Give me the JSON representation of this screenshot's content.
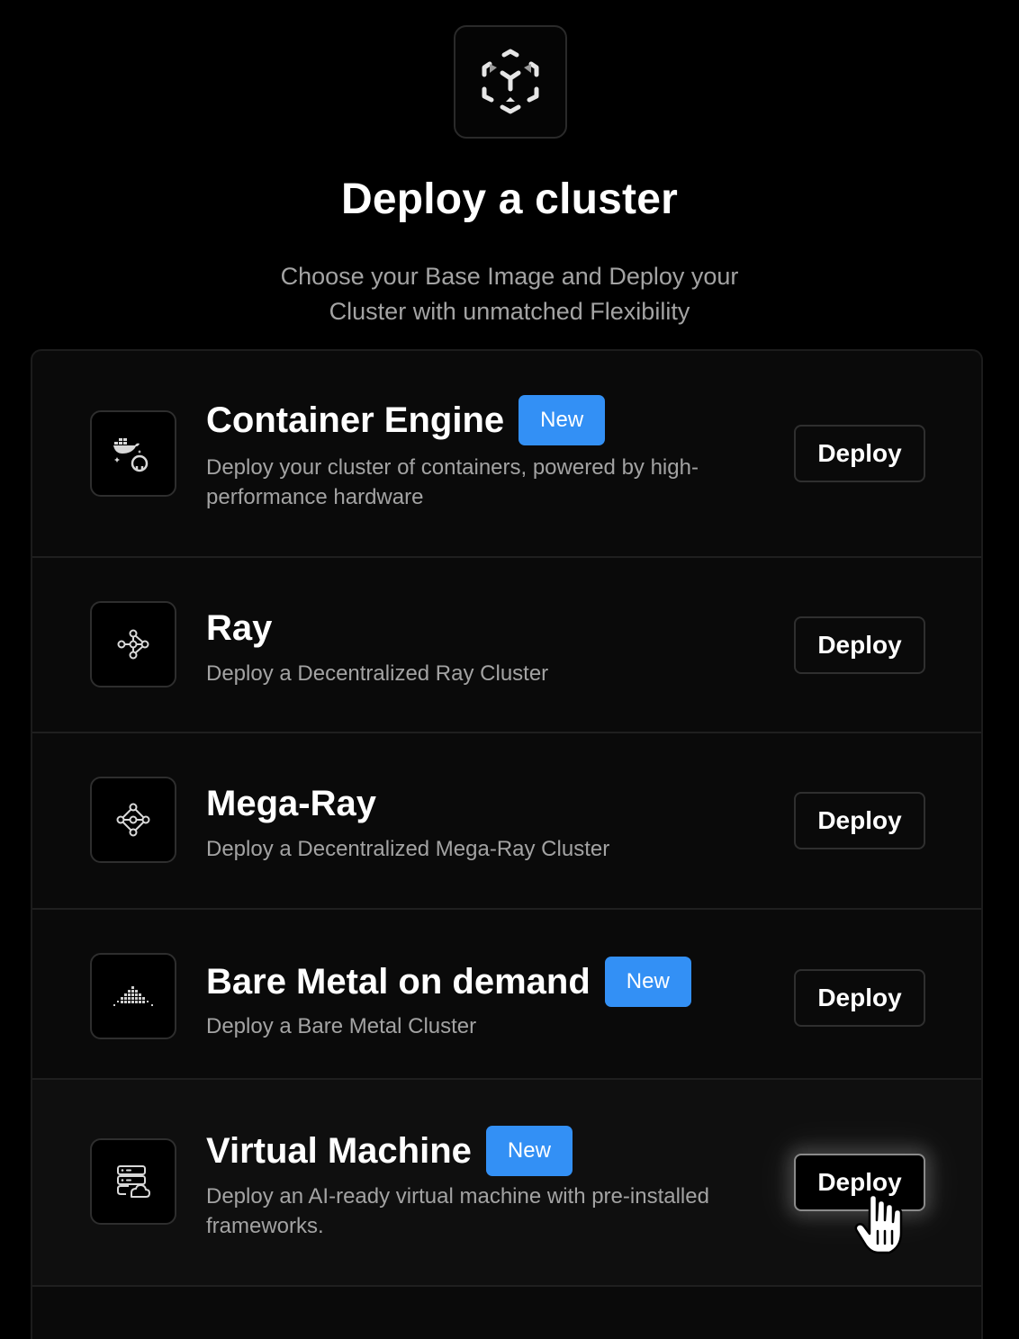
{
  "header": {
    "logo_icon": "cluster-cube-icon",
    "title": "Deploy a cluster",
    "subtitle": "Choose your Base Image and Deploy your Cluster with unmatched Flexibility"
  },
  "options": [
    {
      "icon": "docker-github-icon",
      "title": "Container Engine",
      "badge": "New",
      "description": "Deploy your cluster of containers, powered by high-performance hardware",
      "button_label": "Deploy"
    },
    {
      "icon": "ray-nodes-icon",
      "title": "Ray",
      "badge": "",
      "description": "Deploy a Decentralized Ray Cluster",
      "button_label": "Deploy"
    },
    {
      "icon": "mega-ray-nodes-icon",
      "title": "Mega-Ray",
      "badge": "",
      "description": "Deploy a Decentralized Mega-Ray Cluster",
      "button_label": "Deploy"
    },
    {
      "icon": "bare-metal-dots-icon",
      "title": "Bare Metal on demand",
      "badge": "New",
      "description": "Deploy a Bare Metal Cluster",
      "button_label": "Deploy"
    },
    {
      "icon": "server-cloud-icon",
      "title": "Virtual Machine",
      "badge": "New",
      "description": "Deploy an AI-ready virtual machine with pre-installed frameworks.",
      "button_label": "Deploy"
    }
  ],
  "colors": {
    "background": "#000000",
    "card_background": "#0a0a0a",
    "badge": "#3390f5",
    "muted_text": "#a3a3a3"
  }
}
